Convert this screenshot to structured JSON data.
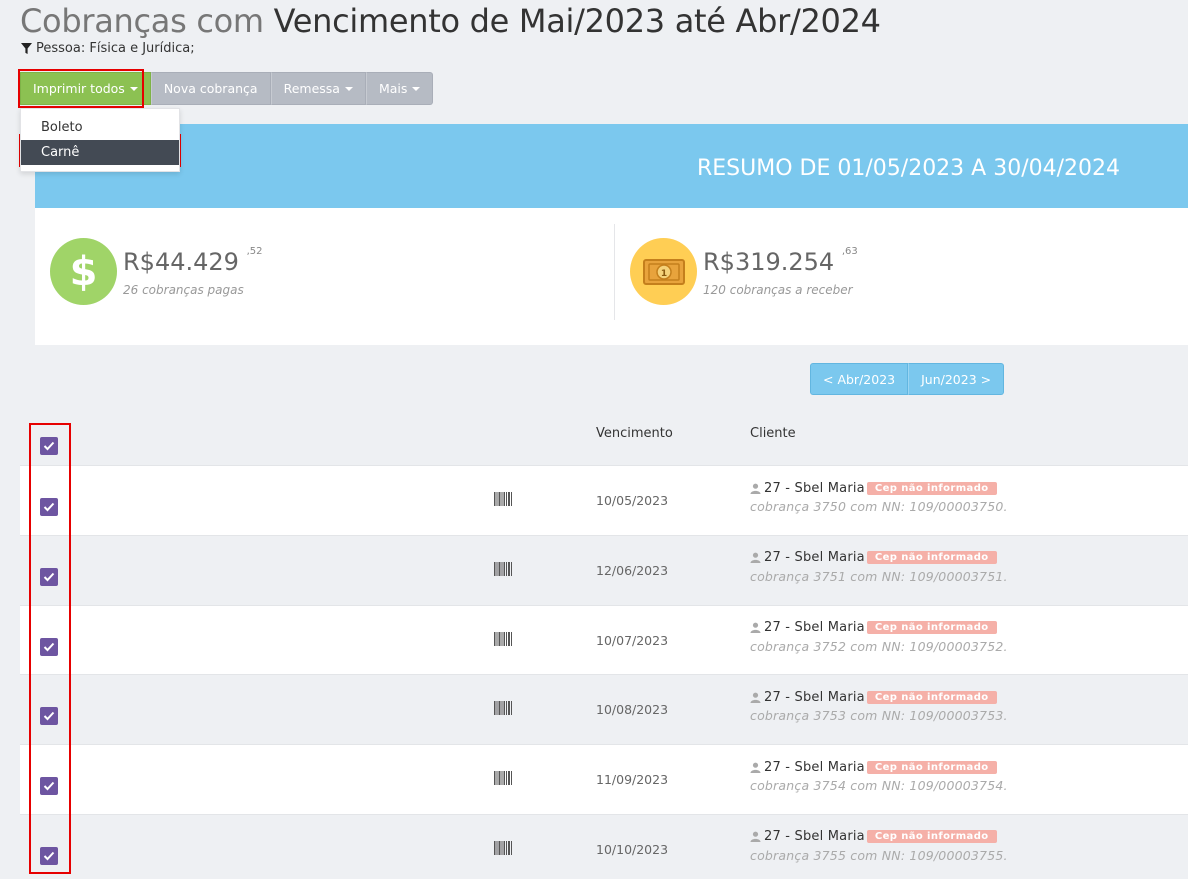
{
  "header": {
    "title_light": "Cobranças com",
    "title_dark": "Vencimento de Mai/2023 até Abr/2024",
    "filter_text": "Pessoa: Física e Jurídica;"
  },
  "toolbar": {
    "print_all_label": "Imprimir todos",
    "new_charge_label": "Nova cobrança",
    "remessa_label": "Remessa",
    "more_label": "Mais"
  },
  "print_menu": {
    "items": [
      {
        "label": "Boleto",
        "active": false
      },
      {
        "label": "Carnê",
        "active": true
      }
    ]
  },
  "summary": {
    "title": "RESUMO DE 01/05/2023 A 30/04/2024",
    "paid": {
      "currency": "R$",
      "amount": "44.429",
      "cents": ",52",
      "caption": "26 cobranças pagas",
      "icon": "dollar-icon",
      "color": "#a0d468"
    },
    "receivable": {
      "currency": "R$",
      "amount": "319.254",
      "cents": ",63",
      "caption": "120 cobranças a receber",
      "icon": "banknote-icon",
      "color": "#ffce54"
    }
  },
  "pager": {
    "prev_label": "< Abr/2023",
    "next_label": "Jun/2023 >"
  },
  "table": {
    "columns": {
      "due": "Vencimento",
      "client": "Cliente"
    },
    "rows": [
      {
        "checked": true,
        "due": "10/05/2023",
        "client": "27 - Sbel Maria",
        "badge": "Cep não informado",
        "detail": "cobrança 3750 com NN: 109/00003750."
      },
      {
        "checked": true,
        "due": "12/06/2023",
        "client": "27 - Sbel Maria",
        "badge": "Cep não informado",
        "detail": "cobrança 3751 com NN: 109/00003751."
      },
      {
        "checked": true,
        "due": "10/07/2023",
        "client": "27 - Sbel Maria",
        "badge": "Cep não informado",
        "detail": "cobrança 3752 com NN: 109/00003752."
      },
      {
        "checked": true,
        "due": "10/08/2023",
        "client": "27 - Sbel Maria",
        "badge": "Cep não informado",
        "detail": "cobrança 3753 com NN: 109/00003753."
      },
      {
        "checked": true,
        "due": "11/09/2023",
        "client": "27 - Sbel Maria",
        "badge": "Cep não informado",
        "detail": "cobrança 3754 com NN: 109/00003754."
      },
      {
        "checked": true,
        "due": "10/10/2023",
        "client": "27 - Sbel Maria",
        "badge": "Cep não informado",
        "detail": "cobrança 3755 com NN: 109/00003755."
      }
    ]
  },
  "colors": {
    "accent_green": "#8cc152",
    "header_blue": "#7bc8ee",
    "checkbox_purple": "#6d55a1",
    "highlight_red": "#e60000"
  }
}
